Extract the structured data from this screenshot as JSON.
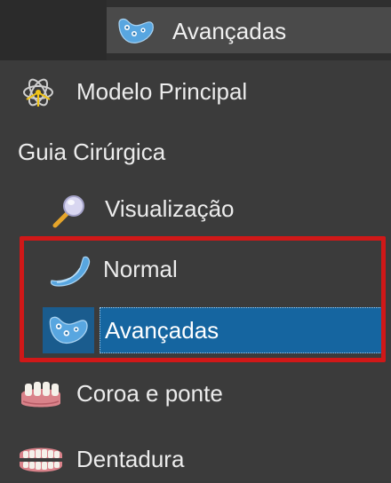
{
  "header": {
    "active_label": "Avançadas",
    "active_icon": "advanced-guide-icon"
  },
  "tree": {
    "items": [
      {
        "label": "Modelo Principal",
        "icon": "molecule-icon"
      },
      {
        "label": "Guia Cirúrgica"
      },
      {
        "label": "Visualização",
        "icon": "magnifier-icon"
      },
      {
        "label": "Normal",
        "icon": "normal-guide-icon"
      },
      {
        "label": "Avançadas",
        "icon": "advanced-guide-icon",
        "selected": true
      },
      {
        "label": "Coroa e ponte",
        "icon": "crown-bridge-icon"
      },
      {
        "label": "Dentadura",
        "icon": "denture-icon"
      }
    ]
  },
  "colors": {
    "background": "#3b3b3b",
    "selection": "#1565a0",
    "highlight_box": "#d01818",
    "guide_blue": "#58a6e0"
  }
}
